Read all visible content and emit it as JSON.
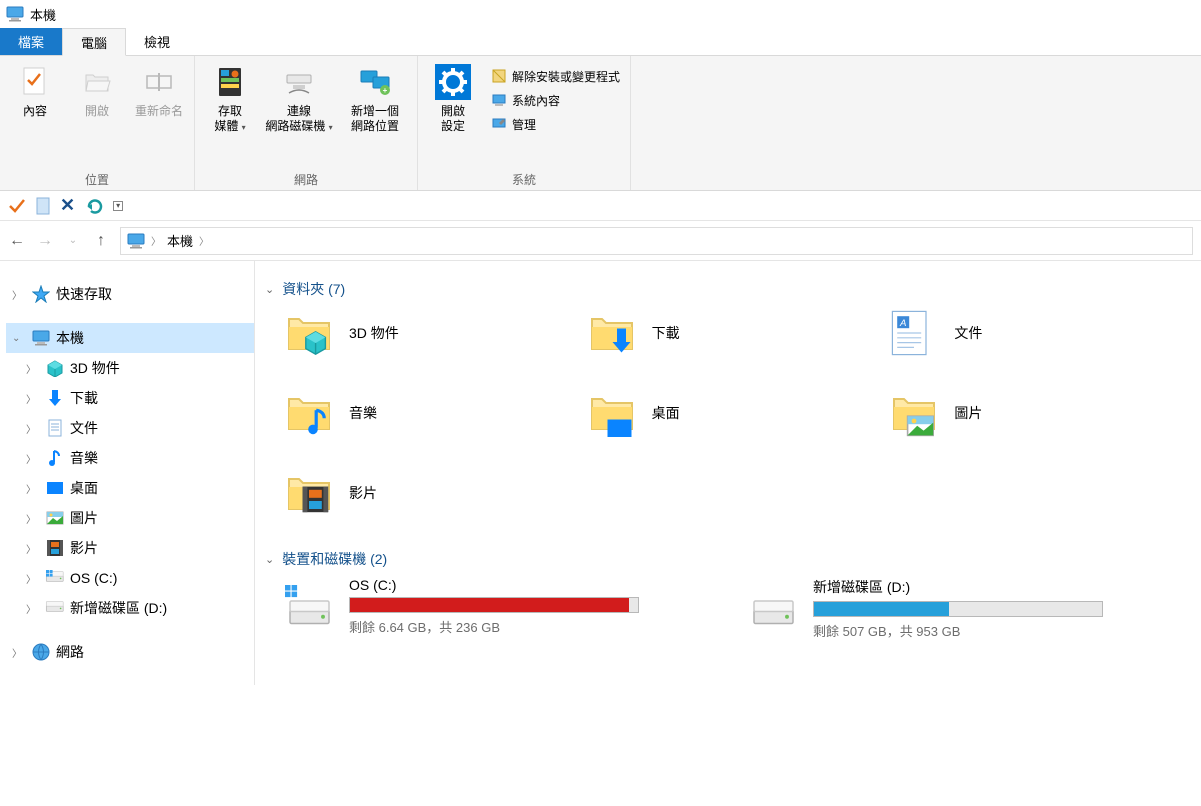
{
  "window": {
    "title": "本機"
  },
  "tabs": {
    "file": "檔案",
    "computer": "電腦",
    "view": "檢視"
  },
  "ribbon": {
    "location": {
      "label": "位置",
      "properties": "內容",
      "open": "開啟",
      "rename": "重新命名"
    },
    "network": {
      "label": "網路",
      "media": "存取\n媒體",
      "mapdrive": "連線\n網路磁碟機",
      "addlocation": "新增一個\n網路位置"
    },
    "system": {
      "label": "系統",
      "settings": "開啟\n設定",
      "uninstall": "解除安裝或變更程式",
      "sysprops": "系統內容",
      "manage": "管理"
    }
  },
  "breadcrumb": {
    "root": "本機"
  },
  "tree": {
    "quick": "快速存取",
    "thispc": "本機",
    "objects3d": "3D 物件",
    "downloads": "下載",
    "documents": "文件",
    "music": "音樂",
    "desktop": "桌面",
    "pictures": "圖片",
    "videos": "影片",
    "driveC": "OS (C:)",
    "driveD": "新增磁碟區 (D:)",
    "network": "網路"
  },
  "sections": {
    "folders": "資料夾 (7)",
    "drives": "裝置和磁碟機 (2)"
  },
  "folders": {
    "objects3d": "3D 物件",
    "downloads": "下載",
    "documents": "文件",
    "music": "音樂",
    "desktop": "桌面",
    "pictures": "圖片",
    "videos": "影片"
  },
  "drives": [
    {
      "name": "OS (C:)",
      "status": "剩餘 6.64 GB，共 236 GB",
      "percent": 97,
      "color": "red"
    },
    {
      "name": "新增磁碟區 (D:)",
      "status": "剩餘 507 GB，共 953 GB",
      "percent": 47,
      "color": "blue"
    }
  ]
}
